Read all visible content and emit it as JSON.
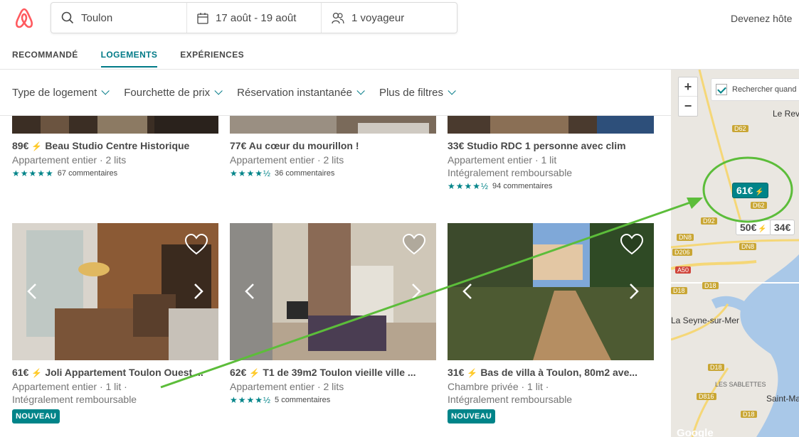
{
  "header": {
    "search_location": "Toulon",
    "search_dates": "17 août - 19 août",
    "search_guests": "1 voyageur",
    "host_link": "Devenez hôte",
    "brand_color": "#ff5a5f"
  },
  "tabs": [
    {
      "label": "RECOMMANDÉ",
      "active": false
    },
    {
      "label": "LOGEMENTS",
      "active": true
    },
    {
      "label": "EXPÉRIENCES",
      "active": false
    }
  ],
  "filters": [
    "Type de logement",
    "Fourchette de prix",
    "Réservation instantanée",
    "Plus de filtres"
  ],
  "listings_row1": [
    {
      "price": "89€",
      "title": "Beau Studio Centre Historique",
      "type": "Appartement entier · 2 lits",
      "extra": "",
      "stars": 5,
      "reviews": "67 commentaires"
    },
    {
      "price": "77€",
      "title": "Au cœur du mourillon !",
      "type": "Appartement entier · 2 lits",
      "extra": "",
      "stars": 4.5,
      "reviews": "36 commentaires"
    },
    {
      "price": "33€",
      "title": "Studio RDC 1 personne avec clim",
      "type": "Appartement entier · 1 lit",
      "extra": "Intégralement remboursable",
      "stars": 4.5,
      "reviews": "94 commentaires"
    }
  ],
  "listings_row2": [
    {
      "price": "61€",
      "title": "Joli Appartement Toulon Ouest ...",
      "type": "Appartement entier · 1 lit ·",
      "extra": "Intégralement remboursable",
      "badge": "NOUVEAU"
    },
    {
      "price": "62€",
      "title": "T1 de 39m2 Toulon vieille ville ...",
      "type": "Appartement entier · 2 lits",
      "extra": "",
      "stars": 4.5,
      "reviews": "5 commentaires"
    },
    {
      "price": "31€",
      "title": "Bas de villa à Toulon, 80m2 ave...",
      "type": "Chambre privée · 1 lit ·",
      "extra": "Intégralement remboursable",
      "badge": "NOUVEAU"
    }
  ],
  "map": {
    "zoom_in": "+",
    "zoom_out": "−",
    "search_toggle": "Rechercher quand",
    "pins": {
      "active": "61€",
      "p2": "50€",
      "p3": "34€"
    },
    "places": {
      "seyne": "La Seyne-sur-Mer",
      "sablettes": "LES SABLETTES",
      "mandrier": "Saint-Ma",
      "revest": "Le Rev"
    },
    "roads": [
      "D62",
      "D62",
      "D92",
      "DN8",
      "D206",
      "DN8",
      "A50",
      "D18",
      "D18",
      "D18",
      "D816",
      "D18"
    ],
    "google": "Google"
  }
}
